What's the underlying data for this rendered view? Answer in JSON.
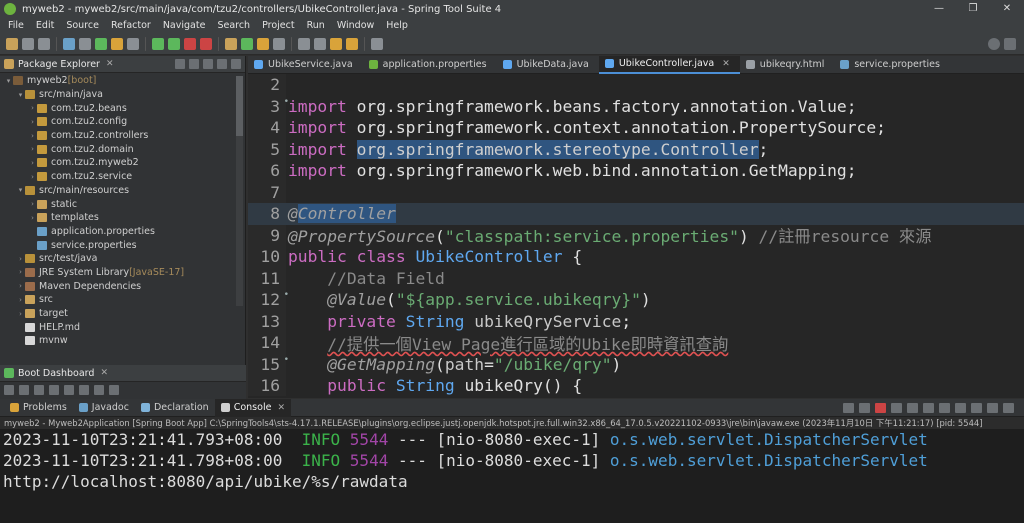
{
  "window": {
    "title": "myweb2 - myweb2/src/main/java/com/tzu2/controllers/UbikeController.java - Spring Tool Suite 4",
    "controls": [
      "—",
      "❐",
      "✕"
    ]
  },
  "menu": [
    "File",
    "Edit",
    "Source",
    "Refactor",
    "Navigate",
    "Search",
    "Project",
    "Run",
    "Window",
    "Help"
  ],
  "package_explorer": {
    "tab_label": "Package Explorer",
    "tree": [
      {
        "label": "myweb2",
        "suffix": " [boot]",
        "toggle": "▾",
        "icon": "proj"
      },
      {
        "label": "src/main/java",
        "suffix": "",
        "toggle": "▾",
        "icon": "srcf"
      },
      {
        "label": "com.tzu2.beans",
        "suffix": "",
        "toggle": "›",
        "icon": "pkg"
      },
      {
        "label": "com.tzu2.config",
        "suffix": "",
        "toggle": "›",
        "icon": "pkg"
      },
      {
        "label": "com.tzu2.controllers",
        "suffix": "",
        "toggle": "›",
        "icon": "pkg"
      },
      {
        "label": "com.tzu2.domain",
        "suffix": "",
        "toggle": "›",
        "icon": "pkg"
      },
      {
        "label": "com.tzu2.myweb2",
        "suffix": "",
        "toggle": "›",
        "icon": "pkg"
      },
      {
        "label": "com.tzu2.service",
        "suffix": "",
        "toggle": "›",
        "icon": "pkg"
      },
      {
        "label": "src/main/resources",
        "suffix": "",
        "toggle": "▾",
        "icon": "srcf"
      },
      {
        "label": "static",
        "suffix": "",
        "toggle": "›",
        "icon": "fold"
      },
      {
        "label": "templates",
        "suffix": "",
        "toggle": "›",
        "icon": "fold"
      },
      {
        "label": "application.properties",
        "suffix": "",
        "toggle": "",
        "icon": "prop"
      },
      {
        "label": "service.properties",
        "suffix": "",
        "toggle": "",
        "icon": "prop"
      },
      {
        "label": "src/test/java",
        "suffix": "",
        "toggle": "›",
        "icon": "srcf"
      },
      {
        "label": "JRE System Library",
        "suffix": " [JavaSE-17]",
        "toggle": "›",
        "icon": "lib"
      },
      {
        "label": "Maven Dependencies",
        "suffix": "",
        "toggle": "›",
        "icon": "lib"
      },
      {
        "label": "src",
        "suffix": "",
        "toggle": "›",
        "icon": "fold"
      },
      {
        "label": "target",
        "suffix": "",
        "toggle": "›",
        "icon": "fold"
      },
      {
        "label": "HELP.md",
        "suffix": "",
        "toggle": "",
        "icon": "file"
      },
      {
        "label": "mvnw",
        "suffix": "",
        "toggle": "",
        "icon": "file"
      }
    ]
  },
  "boot_dashboard": {
    "tab_label": "Boot Dashboard"
  },
  "editor": {
    "tabs": [
      {
        "label": "UbikeService.java",
        "active": false,
        "closable": false
      },
      {
        "label": "application.properties",
        "active": false,
        "closable": false
      },
      {
        "label": "UbikeData.java",
        "active": false,
        "closable": false
      },
      {
        "label": "UbikeController.java",
        "active": true,
        "closable": true
      },
      {
        "label": "ubikeqry.html",
        "active": false,
        "closable": false
      },
      {
        "label": "service.properties",
        "active": false,
        "closable": false
      }
    ],
    "lines": [
      {
        "n": "2",
        "fold": false,
        "cur": false,
        "parts": []
      },
      {
        "n": "3",
        "fold": true,
        "cur": false,
        "parts": [
          [
            "kw",
            "import"
          ],
          [
            "tx",
            " org.springframework.beans.factory.annotation.Value;"
          ]
        ]
      },
      {
        "n": "4",
        "fold": false,
        "cur": false,
        "parts": [
          [
            "kw",
            "import"
          ],
          [
            "tx",
            " org.springframework.context.annotation.PropertySource;"
          ]
        ]
      },
      {
        "n": "5",
        "fold": false,
        "cur": false,
        "parts": [
          [
            "kw",
            "import"
          ],
          [
            "tx",
            " "
          ],
          [
            "sel",
            "org.springframework.stereotype.Controller"
          ],
          [
            "tx",
            ";"
          ]
        ]
      },
      {
        "n": "6",
        "fold": false,
        "cur": false,
        "parts": [
          [
            "kw",
            "import"
          ],
          [
            "tx",
            " org.springframework.web.bind.annotation.GetMapping;"
          ]
        ]
      },
      {
        "n": "7",
        "fold": false,
        "cur": false,
        "parts": []
      },
      {
        "n": "8",
        "fold": false,
        "cur": true,
        "parts": [
          [
            "ann",
            "@"
          ],
          [
            "annsel",
            "Controller"
          ]
        ]
      },
      {
        "n": "9",
        "fold": false,
        "cur": false,
        "parts": [
          [
            "ann",
            "@PropertySource"
          ],
          [
            "tx",
            "("
          ],
          [
            "str",
            "\"classpath:service.properties\""
          ],
          [
            "tx",
            ") "
          ],
          [
            "cm",
            "//註冊resource 來源"
          ]
        ]
      },
      {
        "n": "10",
        "fold": false,
        "cur": false,
        "parts": [
          [
            "kw",
            "public"
          ],
          [
            "tx",
            " "
          ],
          [
            "kw",
            "class"
          ],
          [
            "tx",
            " "
          ],
          [
            "typ",
            "UbikeController"
          ],
          [
            "tx",
            " {"
          ]
        ]
      },
      {
        "n": "11",
        "fold": false,
        "cur": false,
        "parts": [
          [
            "tx",
            "    "
          ],
          [
            "cm",
            "//Data Field"
          ]
        ]
      },
      {
        "n": "12",
        "fold": true,
        "cur": false,
        "parts": [
          [
            "tx",
            "    "
          ],
          [
            "ann",
            "@Value"
          ],
          [
            "tx",
            "("
          ],
          [
            "str",
            "\"${app.service.ubikeqry}\""
          ],
          [
            "tx",
            ")"
          ]
        ]
      },
      {
        "n": "13",
        "fold": false,
        "cur": false,
        "parts": [
          [
            "tx",
            "    "
          ],
          [
            "kw",
            "private"
          ],
          [
            "tx",
            " "
          ],
          [
            "typ",
            "String"
          ],
          [
            "tx",
            " "
          ],
          [
            "fld",
            "ubikeQryService"
          ],
          [
            "tx",
            ";"
          ]
        ]
      },
      {
        "n": "14",
        "fold": false,
        "cur": false,
        "parts": [
          [
            "tx",
            "    "
          ],
          [
            "cm",
            "//提供一個View Page進行區域的Ubike即時資訊查詢"
          ]
        ]
      },
      {
        "n": "15",
        "fold": true,
        "cur": false,
        "parts": [
          [
            "tx",
            "    "
          ],
          [
            "ann",
            "@GetMapping"
          ],
          [
            "tx",
            "("
          ],
          [
            "fld",
            "path"
          ],
          [
            "tx",
            "="
          ],
          [
            "str",
            "\"/ubike/qry\""
          ],
          [
            "tx",
            ")"
          ]
        ]
      },
      {
        "n": "16",
        "fold": false,
        "cur": false,
        "parts": [
          [
            "tx",
            "    "
          ],
          [
            "kw",
            "public"
          ],
          [
            "tx",
            " "
          ],
          [
            "typ",
            "String"
          ],
          [
            "tx",
            " ubikeQry() {"
          ]
        ]
      }
    ]
  },
  "bottom": {
    "tabs": [
      {
        "label": "Problems",
        "active": false,
        "icon": "#d9a33a"
      },
      {
        "label": "Javadoc",
        "active": false,
        "icon": "#6aa0c8"
      },
      {
        "label": "Declaration",
        "active": false,
        "icon": "#7fb3d9"
      },
      {
        "label": "Console",
        "active": true,
        "icon": "#cfcfcf"
      }
    ],
    "launch_info": "myweb2 - Myweb2Application [Spring Boot App] C:\\SpringTools4\\sts-4.17.1.RELEASE\\plugins\\org.eclipse.justj.openjdk.hotspot.jre.full.win32.x86_64_17.0.5.v20221102-0933\\jre\\bin\\javaw.exe  (2023年11月10日 下午11:21:17) [pid: 5544]",
    "console_lines": [
      {
        "ts": "2023-11-10T23:21:41.793+08:00",
        "level": "INFO",
        "pid": "5544",
        "mid": " --- [nio-8080-exec-1] ",
        "logger": "o.s.web.servlet.DispatcherServlet"
      },
      {
        "ts": "2023-11-10T23:21:41.798+08:00",
        "level": "INFO",
        "pid": "5544",
        "mid": " --- [nio-8080-exec-1] ",
        "logger": "o.s.web.servlet.DispatcherServlet"
      },
      {
        "plain": "http://localhost:8080/api/ubike/%s/rawdata"
      }
    ]
  }
}
